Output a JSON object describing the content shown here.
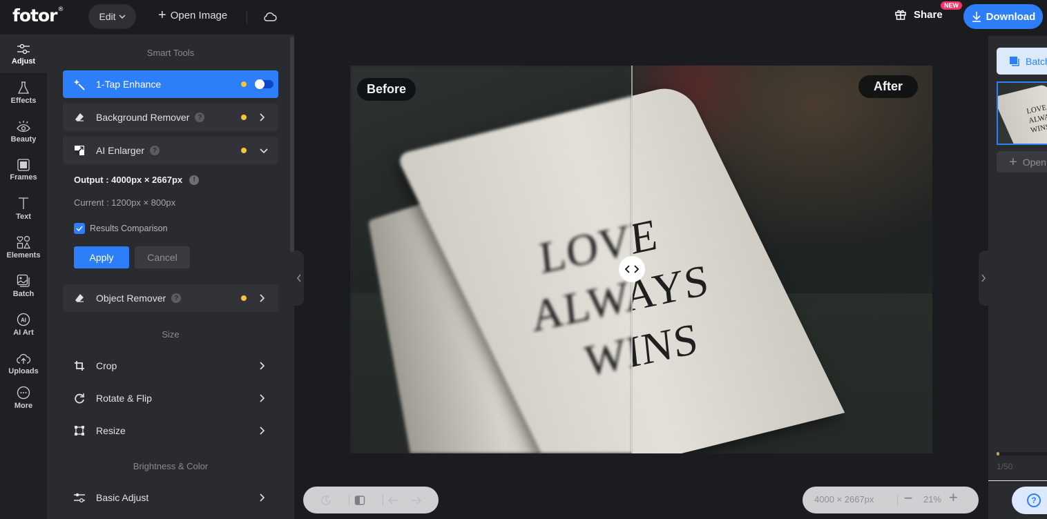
{
  "topbar": {
    "logo": "fotor",
    "logo_mark": "®",
    "edit_label": "Edit",
    "open_image_label": "Open Image",
    "share_label": "Share",
    "new_badge": "NEW",
    "download_label": "Download"
  },
  "nav": {
    "items": [
      {
        "label": "Adjust",
        "icon": "sliders-icon",
        "active": true
      },
      {
        "label": "Effects",
        "icon": "flask-icon"
      },
      {
        "label": "Beauty",
        "icon": "eye-icon"
      },
      {
        "label": "Frames",
        "icon": "frame-icon"
      },
      {
        "label": "Text",
        "icon": "text-icon"
      },
      {
        "label": "Elements",
        "icon": "shapes-icon"
      },
      {
        "label": "Batch",
        "icon": "batch-images-icon"
      },
      {
        "label": "AI Art",
        "icon": "ai-circle-icon"
      },
      {
        "label": "Uploads",
        "icon": "cloud-upload-icon"
      },
      {
        "label": "More",
        "icon": "more-dots-icon"
      }
    ]
  },
  "panel": {
    "smart_tools_title": "Smart Tools",
    "tools": [
      {
        "label": "1-Tap Enhance",
        "icon": "magic-wand-icon",
        "toggle_on": false
      },
      {
        "label": "Background Remover",
        "icon": "eraser-icon",
        "help": "?"
      },
      {
        "label": "AI Enlarger",
        "icon": "enlarge-icon",
        "help": "?",
        "expanded": true
      },
      {
        "label": "Object Remover",
        "icon": "eraser-icon",
        "help": "?"
      }
    ],
    "enlarger": {
      "output": "Output : 4000px × 2667px",
      "info": "!",
      "current": "Current : 1200px × 800px",
      "results_comparison": "Results Comparison",
      "results_comparison_checked": true,
      "apply": "Apply",
      "cancel": "Cancel"
    },
    "size_title": "Size",
    "size_tools": [
      {
        "label": "Crop",
        "icon": "crop-icon"
      },
      {
        "label": "Rotate & Flip",
        "icon": "rotate-icon"
      },
      {
        "label": "Resize",
        "icon": "resize-icon"
      }
    ],
    "brightness_title": "Brightness & Color",
    "brightness_tools": [
      {
        "label": "Basic Adjust",
        "icon": "sliders-icon"
      }
    ]
  },
  "canvas": {
    "before_label": "Before",
    "after_label": "After",
    "book_lines": [
      "LOVE",
      "ALWAYS",
      "WINS"
    ]
  },
  "bottom": {
    "dimensions": "4000 × 2667px",
    "zoom": "21%",
    "minus": "−",
    "plus": "+"
  },
  "right": {
    "batch_label": "Batch",
    "thumb_lines": [
      "LOVE",
      "ALWAYS",
      "WINS"
    ],
    "open_label": "Open",
    "page_count": "1/50",
    "progress": 0.02
  },
  "colors": {
    "accent": "#2d7ff9",
    "badge": "#f6346b",
    "dot": "#f9c23c"
  }
}
